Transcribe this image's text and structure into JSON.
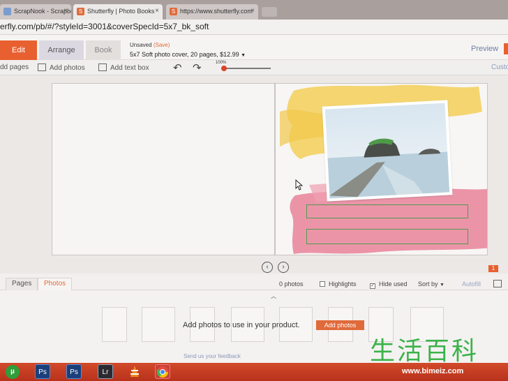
{
  "browser": {
    "tabs": [
      {
        "label": "ScrapNook - Scrapbook I",
        "active": false
      },
      {
        "label": "Shutterfly | Photo Books",
        "active": true
      },
      {
        "label": "https://www.shutterfly.com",
        "active": false
      }
    ],
    "url": "erfly.com/pb/#/?styleId=3001&coverSpecId=5x7_bk_soft"
  },
  "header": {
    "tabs": {
      "edit": "Edit",
      "arrange": "Arrange",
      "book": "Book"
    },
    "unsaved": "Unsaved",
    "save": "(Save)",
    "spec": "5x7 Soft photo cover, 20 pages, $12.99",
    "preview": "Preview"
  },
  "toolbar": {
    "add_pages": "dd pages",
    "add_photos": "Add photos",
    "add_text_box": "Add text box",
    "zoom": "100%",
    "custom": "Custo"
  },
  "canvas": {
    "page_number": "1"
  },
  "panel": {
    "tabs": {
      "pages": "Pages",
      "photos": "Photos"
    },
    "photo_count": "0 photos",
    "highlights": "Highlights",
    "highlights_checked": false,
    "hide_used": "Hide used",
    "hide_used_checked": true,
    "sort_by": "Sort by",
    "autofill": "Autofill"
  },
  "tray": {
    "message": "Add photos to use in your product.",
    "add_button": "Add photos",
    "feedback": "Send us your feedback"
  },
  "watermark": {
    "chinese": "生活百科",
    "url": "www.bimeiz.com"
  },
  "taskbar": {
    "icons": [
      "utorrent",
      "photoshop",
      "photoshop",
      "lightroom",
      "vlc",
      "chrome"
    ],
    "ps_label": "Ps",
    "lr_label": "Lr"
  },
  "colors": {
    "accent": "#e8602f",
    "textbox_border": "#4f9b4f",
    "link": "#6b7fa6"
  }
}
